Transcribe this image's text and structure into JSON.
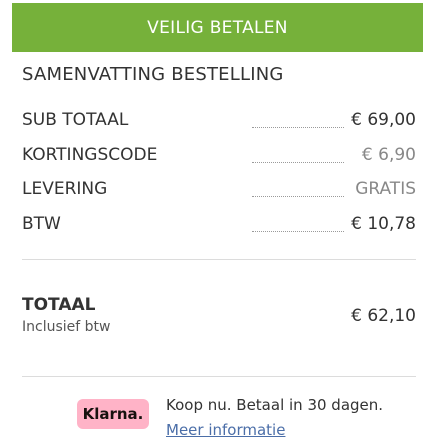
{
  "checkout": {
    "pay_button_label": "VEILIG BETALEN"
  },
  "summary": {
    "title": "SAMENVATTING BESTELLING",
    "rows": [
      {
        "label": "SUB TOTAAL",
        "value": "€ 69,00"
      },
      {
        "label": "KORTINGSCODE",
        "value": "€ 6,90"
      },
      {
        "label": "LEVERING",
        "value": "GRATIS"
      },
      {
        "label": "BTW",
        "value": "€ 10,78"
      }
    ],
    "total": {
      "label": "TOTAAL",
      "note": "Inclusief btw",
      "value": "€ 62,10"
    }
  },
  "klarna": {
    "badge": "Klarna.",
    "text": "Koop nu. Betaal in 30 dagen.",
    "link": "Meer informatie"
  },
  "colors": {
    "accent_green": "#76b13a",
    "klarna_pink": "#ffb3c7",
    "link_blue": "#4b6ea8"
  }
}
